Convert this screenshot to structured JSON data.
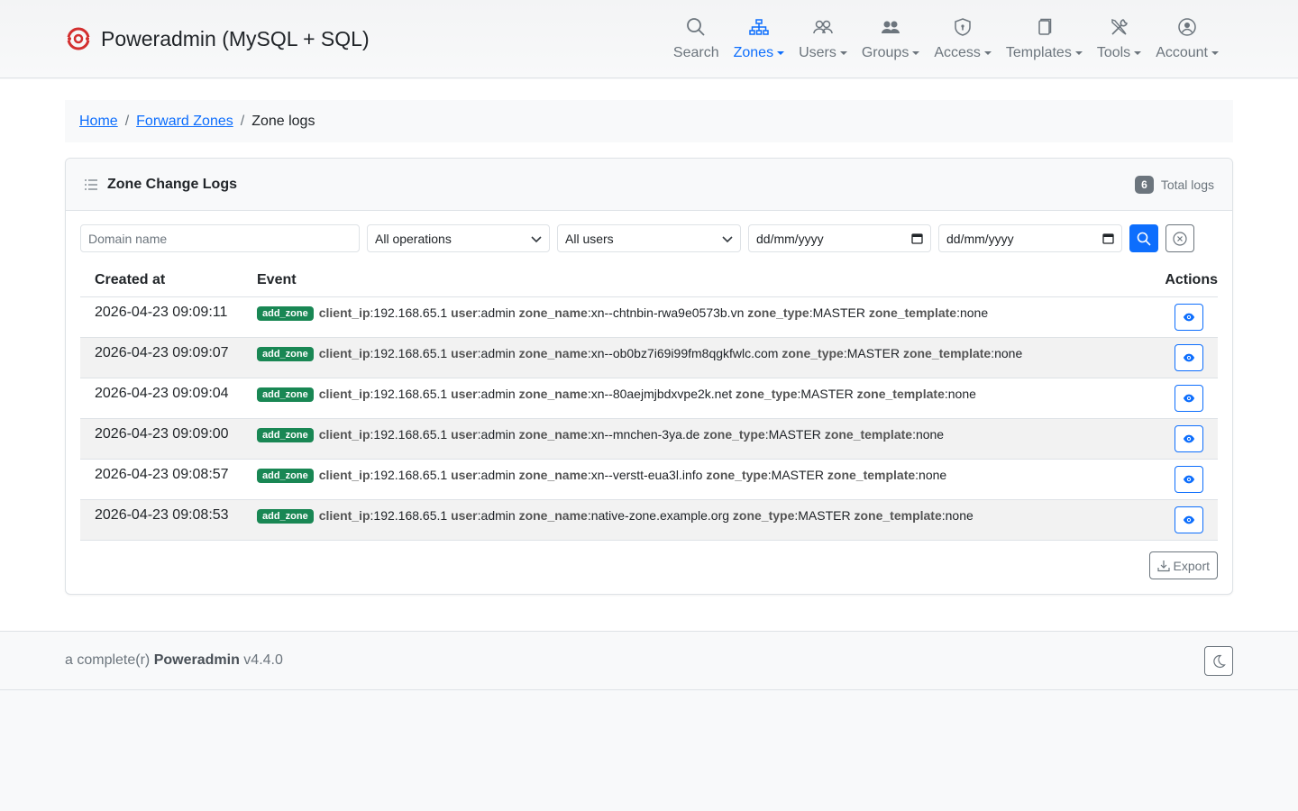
{
  "app": {
    "title": "Poweradmin (MySQL + SQL)"
  },
  "nav": [
    {
      "label": "Search",
      "icon": "search-icon",
      "dropdown": false,
      "active": false
    },
    {
      "label": "Zones",
      "icon": "zones-icon",
      "dropdown": true,
      "active": true
    },
    {
      "label": "Users",
      "icon": "users-icon",
      "dropdown": true,
      "active": false
    },
    {
      "label": "Groups",
      "icon": "groups-icon",
      "dropdown": true,
      "active": false
    },
    {
      "label": "Access",
      "icon": "shield-icon",
      "dropdown": true,
      "active": false
    },
    {
      "label": "Templates",
      "icon": "copy-icon",
      "dropdown": true,
      "active": false
    },
    {
      "label": "Tools",
      "icon": "tools-icon",
      "dropdown": true,
      "active": false
    },
    {
      "label": "Account",
      "icon": "person-icon",
      "dropdown": true,
      "active": false
    }
  ],
  "breadcrumb": {
    "home": "Home",
    "zones": "Forward Zones",
    "current": "Zone logs",
    "separator": "/"
  },
  "card": {
    "title": "Zone Change Logs",
    "total_count": "6",
    "total_label": "Total logs"
  },
  "filters": {
    "domain_placeholder": "Domain name",
    "operation": "All operations",
    "user": "All users",
    "date_from": "dd/mm/yyyy",
    "date_to": "dd/mm/yyyy"
  },
  "table": {
    "headers": {
      "created": "Created at",
      "event": "Event",
      "actions": "Actions"
    },
    "rows": [
      {
        "created": "2026-04-23 09:09:11",
        "op": "add_zone",
        "client_ip": "192.168.65.1",
        "user": "admin",
        "zone_name": "xn--chtnbin-rwa9e0573b.vn",
        "zone_type": "MASTER",
        "zone_template": "none"
      },
      {
        "created": "2026-04-23 09:09:07",
        "op": "add_zone",
        "client_ip": "192.168.65.1",
        "user": "admin",
        "zone_name": "xn--ob0bz7i69i99fm8qgkfwlc.com",
        "zone_type": "MASTER",
        "zone_template": "none"
      },
      {
        "created": "2026-04-23 09:09:04",
        "op": "add_zone",
        "client_ip": "192.168.65.1",
        "user": "admin",
        "zone_name": "xn--80aejmjbdxvpe2k.net",
        "zone_type": "MASTER",
        "zone_template": "none"
      },
      {
        "created": "2026-04-23 09:09:00",
        "op": "add_zone",
        "client_ip": "192.168.65.1",
        "user": "admin",
        "zone_name": "xn--mnchen-3ya.de",
        "zone_type": "MASTER",
        "zone_template": "none"
      },
      {
        "created": "2026-04-23 09:08:57",
        "op": "add_zone",
        "client_ip": "192.168.65.1",
        "user": "admin",
        "zone_name": "xn--verstt-eua3l.info",
        "zone_type": "MASTER",
        "zone_template": "none"
      },
      {
        "created": "2026-04-23 09:08:53",
        "op": "add_zone",
        "client_ip": "192.168.65.1",
        "user": "admin",
        "zone_name": "native-zone.example.org",
        "zone_type": "MASTER",
        "zone_template": "none"
      }
    ],
    "field_labels": {
      "client_ip": "client_ip",
      "user": "user",
      "zone_name": "zone_name",
      "zone_type": "zone_type",
      "zone_template": "zone_template"
    }
  },
  "export_label": "Export",
  "footer": {
    "prefix": "a complete(r)",
    "product": "Poweradmin",
    "version": "v4.4.0"
  },
  "colors": {
    "primary": "#0d6efd",
    "success_badge": "#198754",
    "brand_red": "#d32f2f"
  }
}
